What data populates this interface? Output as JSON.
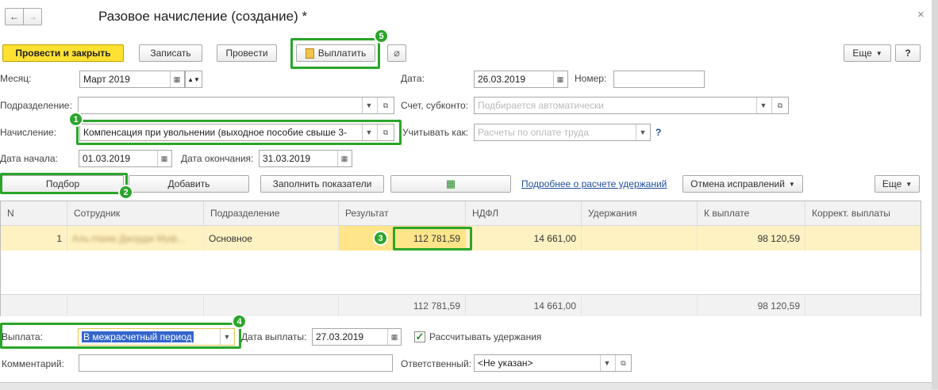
{
  "window": {
    "title": "Разовое начисление (создание) *",
    "close": "×",
    "back": "←",
    "forward": "→"
  },
  "toolbar": {
    "post_close": "Провести и закрыть",
    "save": "Записать",
    "post": "Провести",
    "pay": "Выплатить",
    "more": "Еще",
    "help": "?"
  },
  "header": {
    "month_label": "Месяц:",
    "month_value": "Март 2019",
    "date_label": "Дата:",
    "date_value": "26.03.2019",
    "number_label": "Номер:",
    "number_value": "",
    "division_label": "Подразделение:",
    "division_value": "",
    "account_label": "Счет, субконто:",
    "account_placeholder": "Подбирается автоматически",
    "accrual_label": "Начисление:",
    "accrual_value": "Компенсация при увольнении (выходное пособие свыше 3-",
    "account_as_label": "Учитывать как:",
    "account_as_placeholder": "Расчеты по оплате труда",
    "account_as_help": "?",
    "start_label": "Дата начала:",
    "start_value": "01.03.2019",
    "end_label": "Дата окончания:",
    "end_value": "31.03.2019"
  },
  "table_toolbar": {
    "select": "Подбор",
    "add": "Добавить",
    "fill": "Заполнить показатели",
    "details_link": "Подробнее о расчете удержаний",
    "cancel_fix": "Отмена исправлений",
    "more": "Еще"
  },
  "table": {
    "columns": [
      "N",
      "Сотрудник",
      "Подразделение",
      "Результат",
      "НДФЛ",
      "Удержания",
      "К выплате",
      "Коррект. выплаты"
    ],
    "rows": [
      {
        "n": "1",
        "employee": "Аль-Наим Джордж Муф...",
        "division": "Основное",
        "result": "112 781,59",
        "ndfl": "14 661,00",
        "deductions": "",
        "payout": "98 120,59",
        "correction": ""
      }
    ],
    "totals": {
      "result": "112 781,59",
      "ndfl": "14 661,00",
      "payout": "98 120,59"
    }
  },
  "footer": {
    "payment_label": "Выплата:",
    "payment_value": "В межрасчетный период",
    "pay_date_label": "Дата выплаты:",
    "pay_date_value": "27.03.2019",
    "calc_deductions_label": "Рассчитывать удержания",
    "calc_deductions_checked": true,
    "comment_label": "Комментарий:",
    "comment_value": "",
    "responsible_label": "Ответственный:",
    "responsible_value": "<Не указан>"
  },
  "badges": {
    "b1": "1",
    "b2": "2",
    "b3": "3",
    "b4": "4",
    "b5": "5"
  },
  "colors": {
    "accent_green": "#2aa52a",
    "primary_yellow": "#ffe132",
    "selected_row": "#fff2c2",
    "link": "#1f4e9b"
  }
}
